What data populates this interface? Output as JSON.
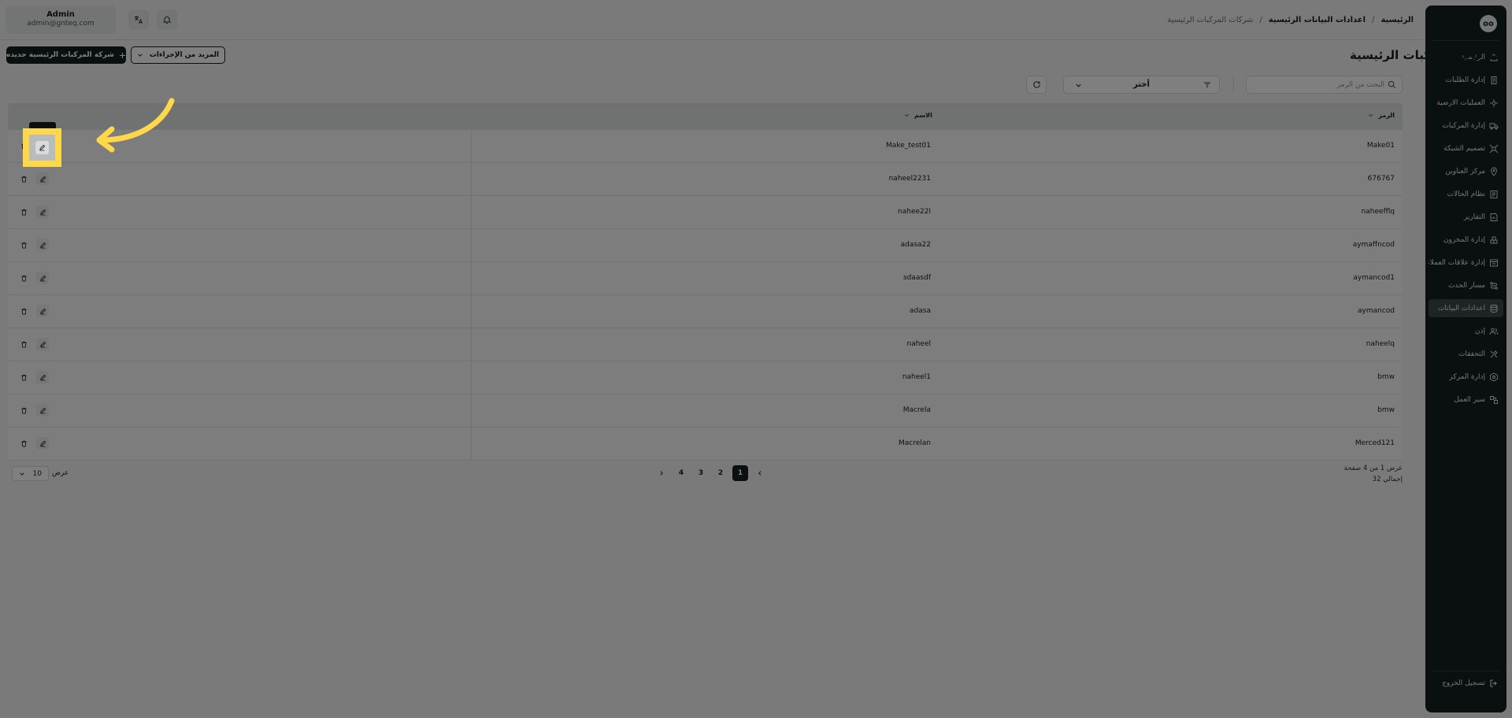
{
  "header": {
    "user_name": "Admin",
    "user_email": "admin@gnteq.com",
    "breadcrumb": [
      {
        "label": "الرئيسية"
      },
      {
        "label": "/"
      },
      {
        "label": "اعدادات البيانات الرئيسية"
      },
      {
        "label": "/"
      },
      {
        "label": "شركات المركبات الرئيسية"
      }
    ]
  },
  "sidebar": {
    "logo_text": "oo",
    "items": [
      {
        "label": "الرئيسية",
        "icon": "home-icon"
      },
      {
        "label": "إدارة الطلبات",
        "icon": "orders-icon"
      },
      {
        "label": "العمليات الارضية",
        "icon": "ground-ops-icon"
      },
      {
        "label": "إدارة المركبات",
        "icon": "truck-icon"
      },
      {
        "label": "تصميم الشبكة",
        "icon": "network-icon"
      },
      {
        "label": "مركز العناوين",
        "icon": "location-icon"
      },
      {
        "label": "نظام الحالات",
        "icon": "status-icon"
      },
      {
        "label": "التقارير",
        "icon": "report-icon"
      },
      {
        "label": "إدارة المخزون",
        "icon": "inventory-icon"
      },
      {
        "label": "إدارة علاقات العملاء",
        "icon": "crm-icon"
      },
      {
        "label": "مسار الحدث",
        "icon": "route-icon"
      },
      {
        "label": "اعدادات البيانات",
        "icon": "database-icon",
        "active": true
      },
      {
        "label": "إذن",
        "icon": "users-icon"
      },
      {
        "label": "التحققات",
        "icon": "tools-icon"
      },
      {
        "label": "إدارة المركز",
        "icon": "center-icon"
      },
      {
        "label": "سير العمل",
        "icon": "workflow-icon"
      }
    ],
    "logout_label": "تسجيل الخروج"
  },
  "page": {
    "title": "شركات المركبات الرئيسية",
    "new_button_label": "شركة المركبات الرئيسية جديده",
    "more_actions_label": "المزيد من الإجراءات",
    "search_placeholder": "البحث من الرمز",
    "filter_label": "أختر"
  },
  "table": {
    "col_code": "الرمز",
    "col_name": "الاسم",
    "rows": [
      {
        "code": "Make01",
        "name": "Make_test01"
      },
      {
        "code": "676767",
        "name": "naheel2231"
      },
      {
        "code": "naheefflq",
        "name": "nahee22l"
      },
      {
        "code": "aymaffncod",
        "name": "adasa22"
      },
      {
        "code": "aymancod1",
        "name": "sdaasdf"
      },
      {
        "code": "aymancod",
        "name": "adasa"
      },
      {
        "code": "naheelq",
        "name": "naheel"
      },
      {
        "code": "bmw",
        "name": "naheel1"
      },
      {
        "code": "bmw",
        "name": "Macrela"
      },
      {
        "code": "Merced121",
        "name": "Macrelan"
      }
    ]
  },
  "pagination": {
    "info_line1": "عرض 1 من 4 صفحة",
    "info_line2": "إجمالي 32",
    "pages": [
      "1",
      "2",
      "3",
      "4"
    ],
    "current_page": "1",
    "page_size": "10",
    "page_size_label": "عرض"
  },
  "colors": {
    "sidebar_bg": "#14211f",
    "primary": "#14211f",
    "highlight": "#ffd84a"
  }
}
